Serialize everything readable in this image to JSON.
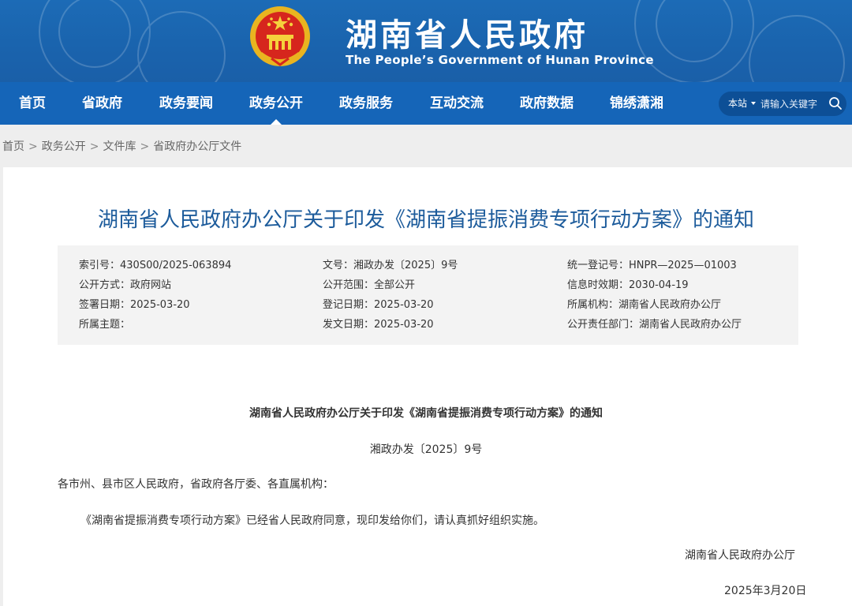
{
  "header": {
    "site_title": "湖南省人民政府",
    "site_subtitle": "The People’s Government of Hunan Province"
  },
  "nav": {
    "items": [
      {
        "label": "首页"
      },
      {
        "label": "省政府"
      },
      {
        "label": "政务要闻"
      },
      {
        "label": "政务公开",
        "active": true
      },
      {
        "label": "政务服务"
      },
      {
        "label": "互动交流"
      },
      {
        "label": "政府数据"
      },
      {
        "label": "锦绣潇湘"
      }
    ],
    "search": {
      "scope_label": "本站",
      "placeholder": "请输入关键字"
    }
  },
  "breadcrumb": [
    "首页",
    "政务公开",
    "文件库",
    "省政府办公厅文件"
  ],
  "document": {
    "title": "湖南省人民政府办公厅关于印发《湖南省提振消费专项行动方案》的通知",
    "meta": {
      "index_no": "索引号：430S00/2025-063894",
      "doc_no": "文号：湘政办发〔2025〕9号",
      "unified_no": "统一登记号：HNPR—2025—01003",
      "publish_method": "公开方式：政府网站",
      "publish_scope": "公开范围：全部公开",
      "expiry": "信息时效期：2030-04-19",
      "sign_date": "签署日期：2025-03-20",
      "register_date": "登记日期：2025-03-20",
      "org": "所属机构：湖南省人民政府办公厅",
      "topic": "所属主题：",
      "issue_date": "发文日期：2025-03-20",
      "dept": "公开责任部门：湖南省人民政府办公厅"
    },
    "inner_title": "湖南省人民政府办公厅关于印发《湖南省提振消费专项行动方案》的通知",
    "doc_number": "湘政办发〔2025〕9号",
    "recipients": "各市州、县市区人民政府，省政府各厅委、各直属机构：",
    "paragraph": "《湖南省提振消费专项行动方案》已经省人民政府同意，现印发给你们，请认真抓好组织实施。",
    "signature": "湖南省人民政府办公厅",
    "date": "2025年3月20日"
  },
  "colors": {
    "banner": "#1a63ad",
    "nav": "#1565b8",
    "title": "#1c5b9b"
  }
}
